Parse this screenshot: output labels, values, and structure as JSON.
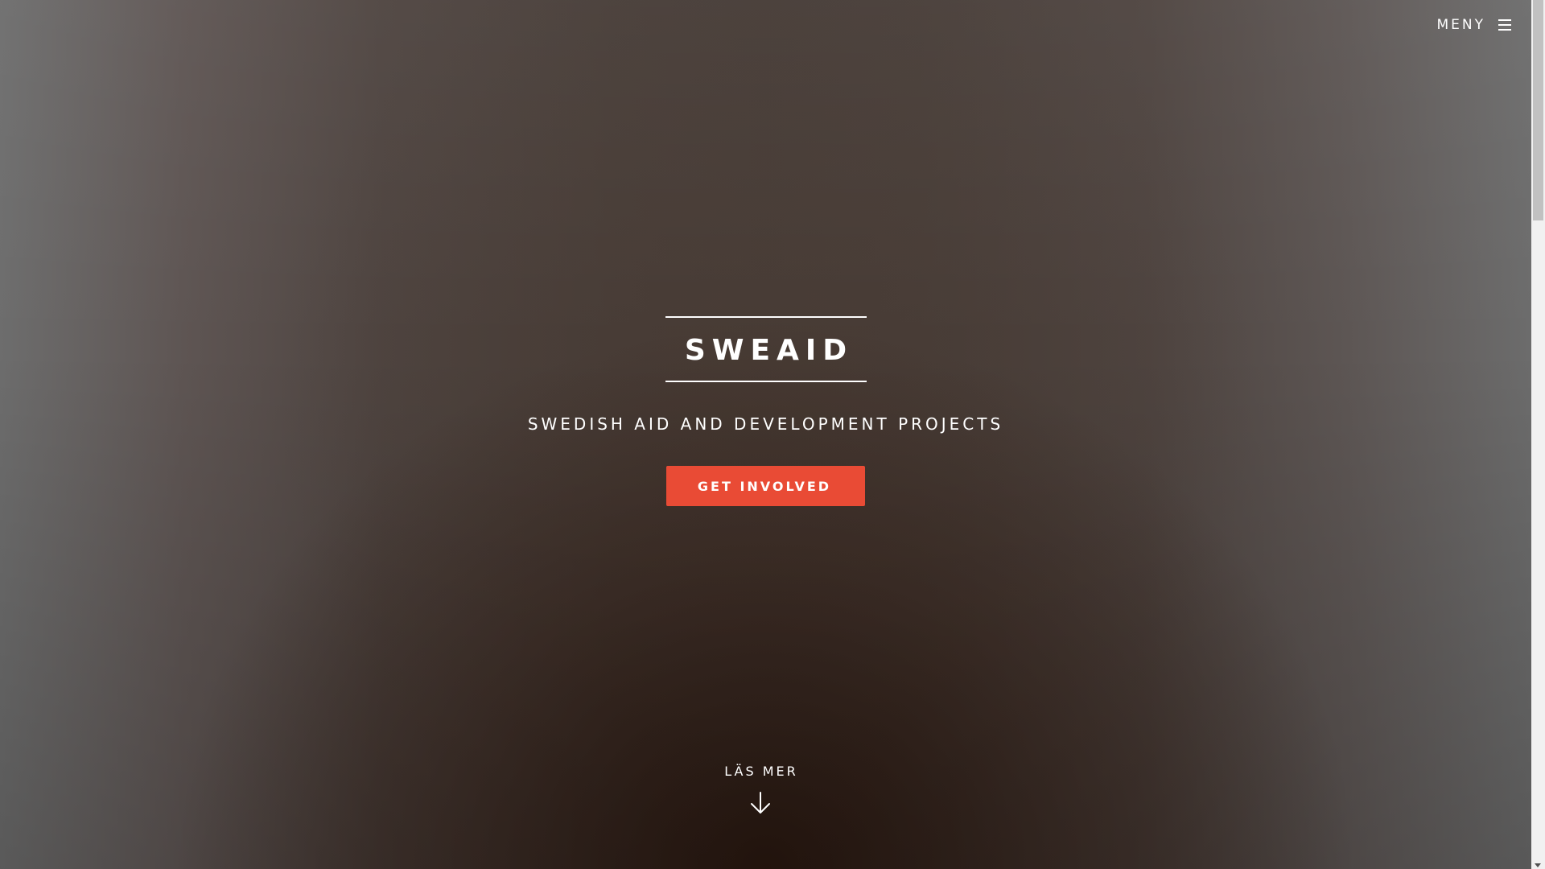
{
  "header": {
    "menu_label": "MENY",
    "menu_icon": "hamburger-icon"
  },
  "hero": {
    "title": "SWEAID",
    "subtitle": "SWEDISH AID AND DEVELOPMENT PROJECTS",
    "cta_label": "GET INVOLVED",
    "read_more_label": "LÄS MER",
    "read_more_icon": "arrow-down-icon"
  },
  "colors": {
    "accent": "#e94b35",
    "text": "#ffffff"
  }
}
